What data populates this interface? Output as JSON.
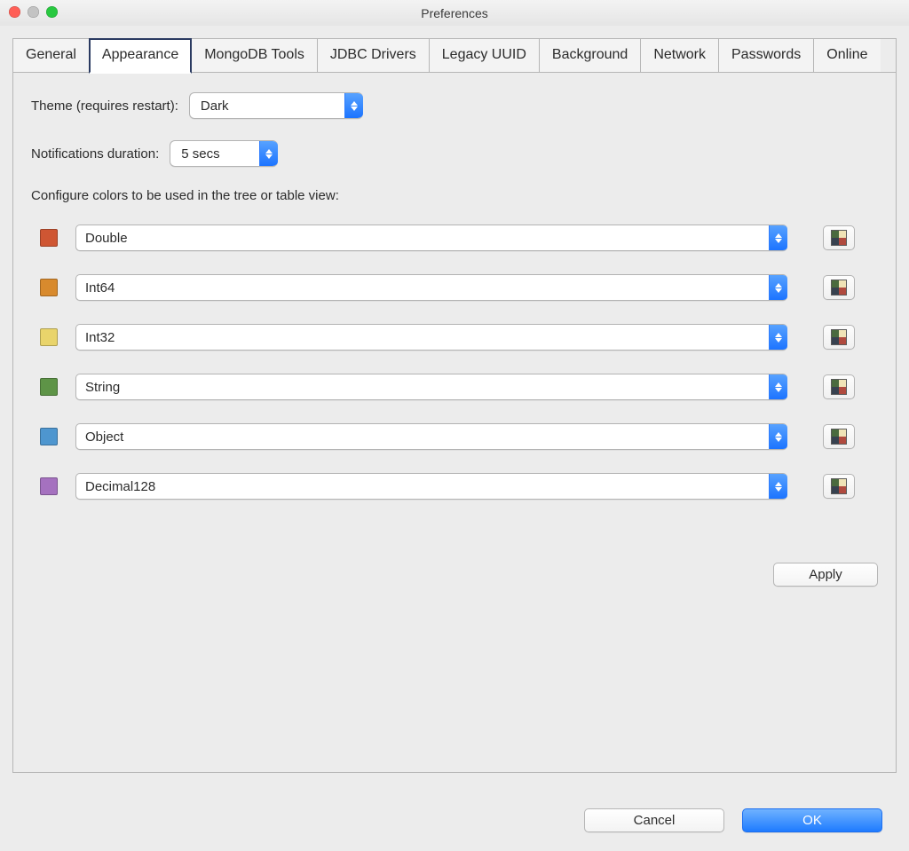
{
  "window": {
    "title": "Preferences"
  },
  "tabs": {
    "general": "General",
    "appearance": "Appearance",
    "mongodb_tools": "MongoDB Tools",
    "jdbc_drivers": "JDBC Drivers",
    "legacy_uuid": "Legacy UUID",
    "background": "Background",
    "network": "Network",
    "passwords": "Passwords",
    "online": "Online",
    "active": "appearance"
  },
  "form": {
    "theme_label": "Theme (requires restart):",
    "theme_value": "Dark",
    "notif_label": "Notifications duration:",
    "notif_value": "5 secs",
    "colors_label": "Configure colors to be used in the tree or table view:"
  },
  "color_rows": [
    {
      "type": "Double",
      "hex": "#cf5633"
    },
    {
      "type": "Int64",
      "hex": "#d88a2d"
    },
    {
      "type": "Int32",
      "hex": "#e9d46b"
    },
    {
      "type": "String",
      "hex": "#5e9447"
    },
    {
      "type": "Object",
      "hex": "#4e96cf"
    },
    {
      "type": "Decimal128",
      "hex": "#a571bf"
    }
  ],
  "buttons": {
    "apply": "Apply",
    "cancel": "Cancel",
    "ok": "OK"
  },
  "palette": {
    "a": "#4a6a3e",
    "b": "#f0e3b6",
    "c": "#37414f",
    "d": "#b04a3e"
  }
}
